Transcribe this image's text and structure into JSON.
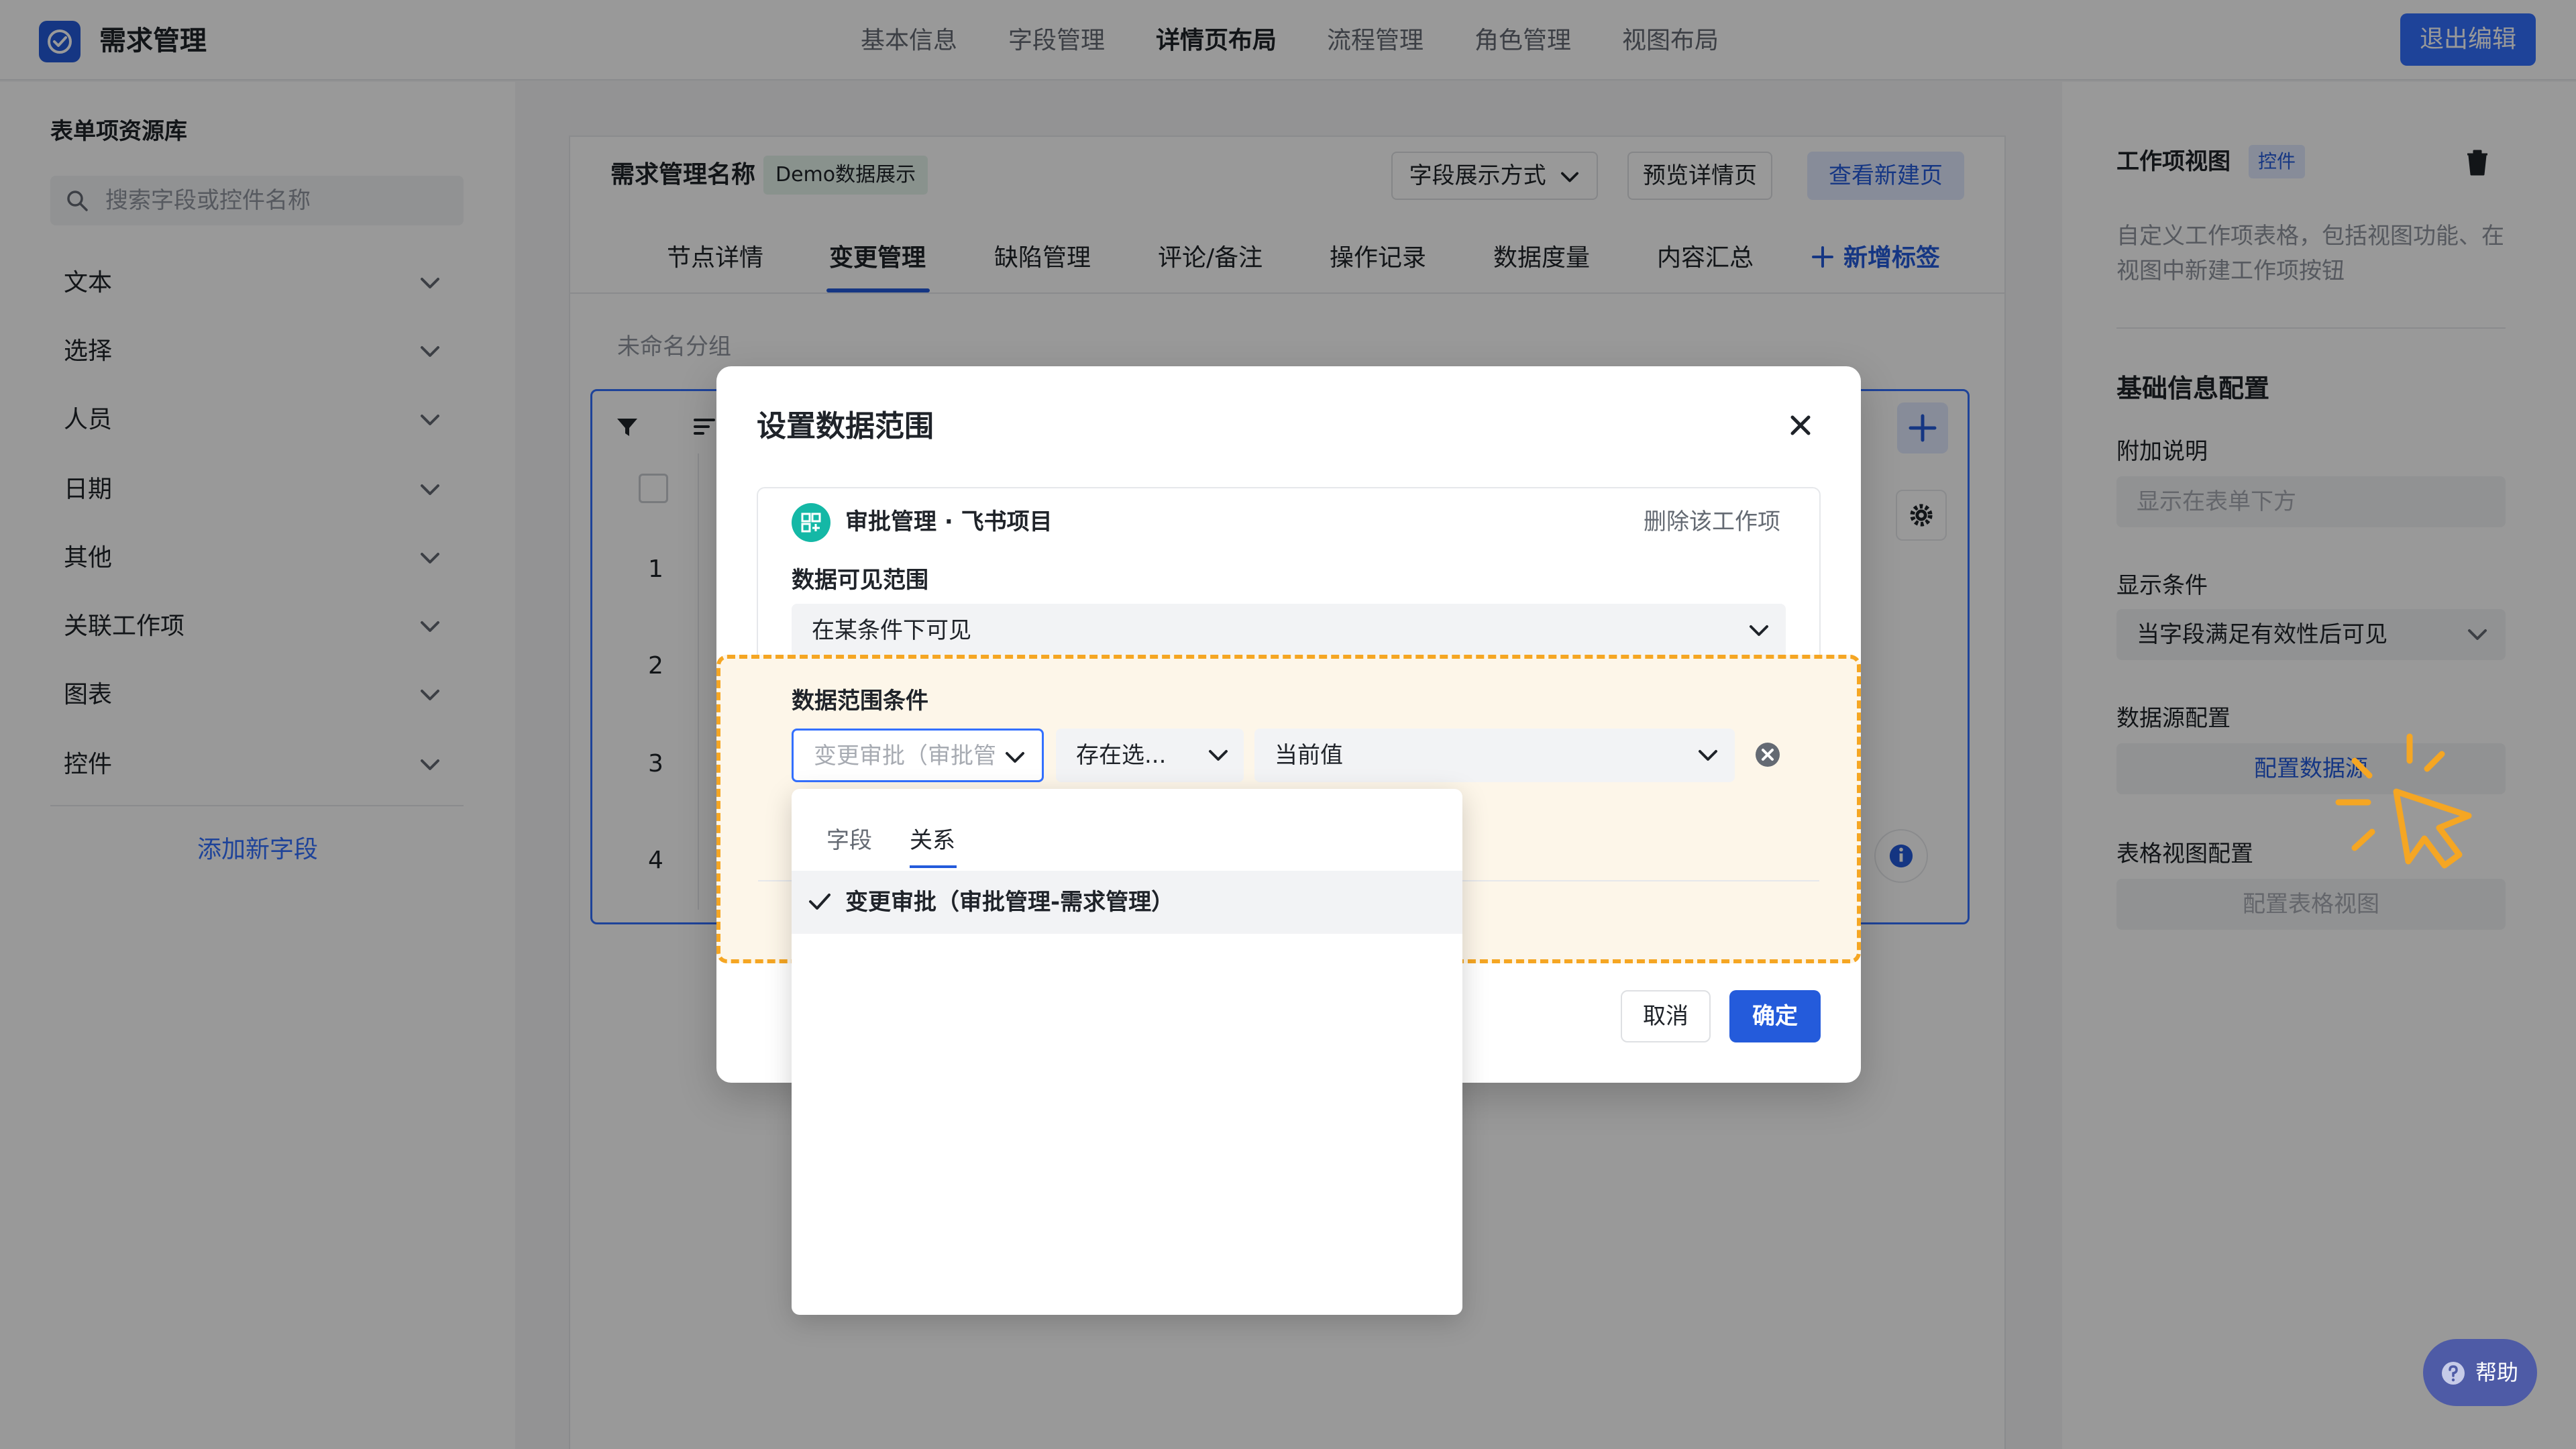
{
  "header": {
    "app_title": "需求管理",
    "nav_tabs": [
      "基本信息",
      "字段管理",
      "详情页布局",
      "流程管理",
      "角色管理",
      "视图布局"
    ],
    "active_tab": "详情页布局",
    "exit_button": "退出编辑"
  },
  "left_panel": {
    "title": "表单项资源库",
    "search_placeholder": "搜索字段或控件名称",
    "categories": [
      "文本",
      "选择",
      "人员",
      "日期",
      "其他",
      "关联工作项",
      "图表",
      "控件"
    ],
    "add_field": "添加新字段"
  },
  "center": {
    "title": "需求管理名称",
    "tag": "Demo数据展示",
    "field_display_button": "字段展示方式",
    "preview_button": "预览详情页",
    "view_new_button": "查看新建页",
    "tabs": [
      "节点详情",
      "变更管理",
      "缺陷管理",
      "评论/备注",
      "操作记录",
      "数据度量",
      "内容汇总"
    ],
    "active_tab": "变更管理",
    "add_tab": "新增标签",
    "group_name": "未命名分组",
    "row_numbers": [
      "1",
      "2",
      "3",
      "4"
    ]
  },
  "right_panel": {
    "title": "工作项视图",
    "tag": "控件",
    "description": "自定义工作项表格，包括视图功能、在视图中新建工作项按钮",
    "section_title": "基础信息配置",
    "note_label": "附加说明",
    "note_placeholder": "显示在表单下方",
    "display_condition_label": "显示条件",
    "display_condition_value": "当字段满足有效性后可见",
    "datasource_label": "数据源配置",
    "datasource_button": "配置数据源",
    "table_view_label": "表格视图配置",
    "table_view_button": "配置表格视图"
  },
  "dialog": {
    "title": "设置数据范围",
    "work_item": "审批管理 · 飞书项目",
    "delete_work_item": "删除该工作项",
    "visibility_label": "数据可见范围",
    "visibility_value": "在某条件下可见",
    "condition_label": "数据范围条件",
    "condition_field_placeholder": "变更审批（审批管",
    "condition_operator": "存在选...",
    "condition_value": "当前值",
    "cancel_button": "取消",
    "ok_button": "确定"
  },
  "dropdown": {
    "tabs": [
      "字段",
      "关系"
    ],
    "active_tab": "关系",
    "options": [
      {
        "label": "变更审批（审批管理-需求管理）",
        "selected": true
      }
    ]
  },
  "help": {
    "label": "帮助"
  },
  "colors": {
    "primary": "#245bdb",
    "highlight_border": "#f5a623",
    "highlight_bg": "#fdf6e9",
    "cursor_accent": "#f5a623"
  },
  "icons": [
    "search-icon",
    "chevron-down-icon",
    "filter-icon",
    "sort-icon",
    "plus-icon",
    "gear-icon",
    "info-icon",
    "trash-icon",
    "close-icon",
    "remove-circle-icon",
    "check-icon",
    "help-icon",
    "pointer-cursor-icon"
  ]
}
